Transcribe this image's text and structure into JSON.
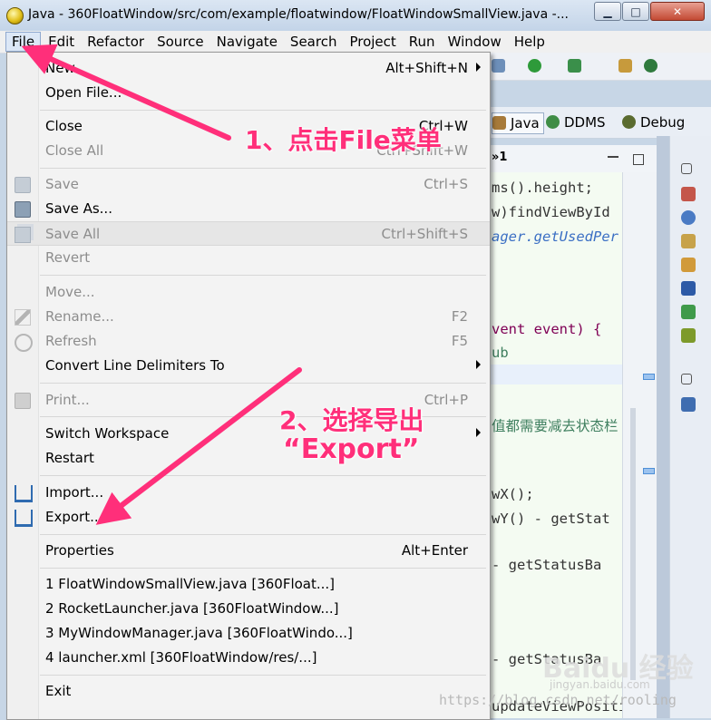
{
  "window": {
    "title": "Java - 360FloatWindow/src/com/example/floatwindow/FloatWindowSmallView.java -...",
    "min_glyph": "▁",
    "max_glyph": "□",
    "close_glyph": "✕"
  },
  "menubar": {
    "items": [
      "File",
      "Edit",
      "Refactor",
      "Source",
      "Navigate",
      "Search",
      "Project",
      "Run",
      "Window",
      "Help"
    ]
  },
  "perspectives": {
    "java": "Java",
    "ddms": "DDMS",
    "debug": "Debug"
  },
  "editor": {
    "tab_overflow": "»1",
    "lines": [
      "ms().height;",
      "w)findViewById",
      "ager.getUsedPer",
      "vent event) {",
      "ub",
      "值都需要减去状态栏",
      "wX();",
      "wY() - getStat",
      "- getStatusBa",
      "- getStatusBa",
      "updateViewPosition();"
    ]
  },
  "file_menu": {
    "items": [
      {
        "label": "New",
        "shortcut": "Alt+Shift+N",
        "submenu": true,
        "enabled": true
      },
      {
        "label": "Open File...",
        "shortcut": "",
        "enabled": true
      },
      {
        "label": "Close",
        "shortcut": "Ctrl+W",
        "enabled": true
      },
      {
        "label": "Close All",
        "shortcut": "Ctrl+Shift+W",
        "enabled": false
      },
      {
        "label": "Save",
        "shortcut": "Ctrl+S",
        "enabled": false
      },
      {
        "label": "Save As...",
        "shortcut": "",
        "enabled": true
      },
      {
        "label": "Save All",
        "shortcut": "Ctrl+Shift+S",
        "enabled": false
      },
      {
        "label": "Revert",
        "shortcut": "",
        "enabled": false
      },
      {
        "label": "Move...",
        "shortcut": "",
        "enabled": false
      },
      {
        "label": "Rename...",
        "shortcut": "F2",
        "enabled": false
      },
      {
        "label": "Refresh",
        "shortcut": "F5",
        "enabled": false
      },
      {
        "label": "Convert Line Delimiters To",
        "shortcut": "",
        "submenu": true,
        "enabled": true
      },
      {
        "label": "Print...",
        "shortcut": "Ctrl+P",
        "enabled": false
      },
      {
        "label": "Switch Workspace",
        "shortcut": "",
        "submenu": true,
        "enabled": true
      },
      {
        "label": "Restart",
        "shortcut": "",
        "enabled": true
      },
      {
        "label": "Import...",
        "shortcut": "",
        "enabled": true
      },
      {
        "label": "Export...",
        "shortcut": "",
        "enabled": true
      },
      {
        "label": "Properties",
        "shortcut": "Alt+Enter",
        "enabled": true
      },
      {
        "label": "1 FloatWindowSmallView.java  [360Float...]",
        "shortcut": "",
        "enabled": true
      },
      {
        "label": "2 RocketLauncher.java  [360FloatWindow...]",
        "shortcut": "",
        "enabled": true
      },
      {
        "label": "3 MyWindowManager.java  [360FloatWindo...]",
        "shortcut": "",
        "enabled": true
      },
      {
        "label": "4 launcher.xml  [360FloatWindow/res/...]",
        "shortcut": "",
        "enabled": true
      },
      {
        "label": "Exit",
        "shortcut": "",
        "enabled": true
      }
    ]
  },
  "annotations": {
    "step1": "1、点击File菜单",
    "step2_line1": "2、选择导出",
    "step2_line2": "“Export”",
    "color": "#ff2f7a"
  },
  "watermarks": {
    "url": "https://blog.csdn.net/rooling",
    "baidu": "Baidu 经验",
    "baidu_sub": "jingyan.baidu.com"
  }
}
